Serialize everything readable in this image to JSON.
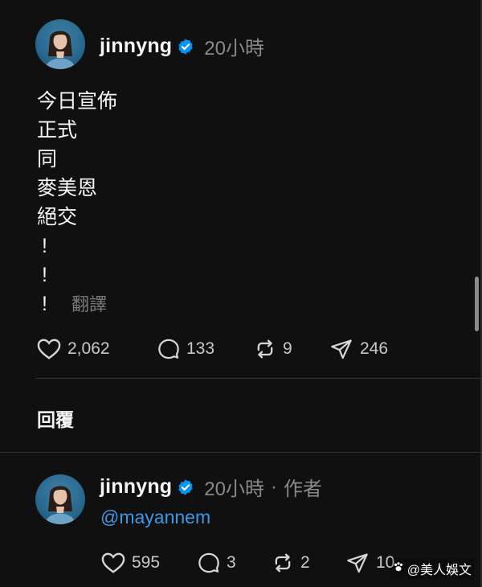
{
  "post": {
    "username": "jinnyng",
    "time": "20小時",
    "lines": [
      "今日宣佈",
      "正式",
      "同",
      "麥美恩",
      "絕交",
      "!",
      "!",
      "!"
    ],
    "translate_label": "翻譯",
    "likes": "2,062",
    "comments": "133",
    "reposts": "9",
    "shares": "246"
  },
  "reply_section_label": "回覆",
  "reply": {
    "username": "jinnyng",
    "time": "20小時",
    "separator": "·",
    "author_tag": "作者",
    "mention": "@mayannem",
    "likes": "595",
    "comments": "3",
    "reposts": "2",
    "shares": "10"
  },
  "watermark": {
    "text": "@美人娛文"
  },
  "colors": {
    "background": "#101010",
    "text": "#f3f5f7",
    "muted": "#8a8a8a",
    "mention": "#3e97e8",
    "verified": "#0095f6"
  },
  "icons": {
    "like": "heart-icon",
    "comment": "comment-bubble-icon",
    "repost": "repost-icon",
    "share": "share-send-icon",
    "verified": "verified-badge-icon"
  }
}
